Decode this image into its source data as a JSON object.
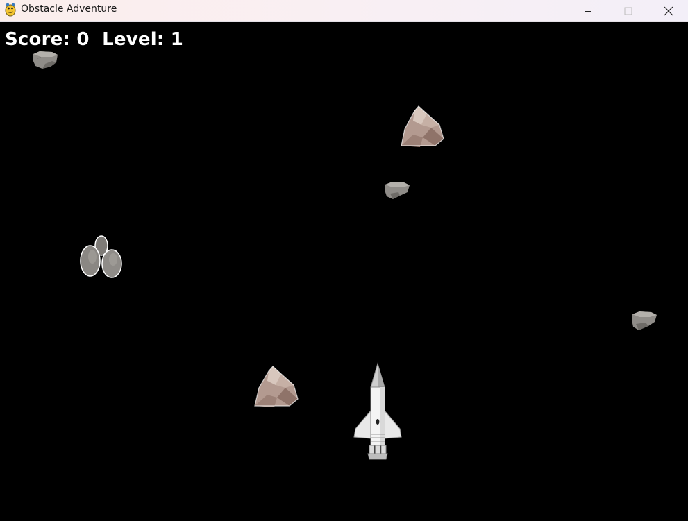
{
  "window": {
    "title": "Obstacle Adventure",
    "controls": [
      "minimize",
      "maximize",
      "close"
    ]
  },
  "hud": {
    "score_label": "Score:",
    "score": "0",
    "level_label": "Level:",
    "level": "1"
  },
  "sprites": {
    "player": "rocket-icon",
    "obstacles": [
      "rock-icon",
      "boulder-icon",
      "pebbles-icon"
    ]
  },
  "colors": {
    "background": "#000000",
    "hud_text": "#ffffff",
    "boulder": "#b39a90",
    "rock": "#8f8c88",
    "rocket": "#f2f2f2"
  }
}
